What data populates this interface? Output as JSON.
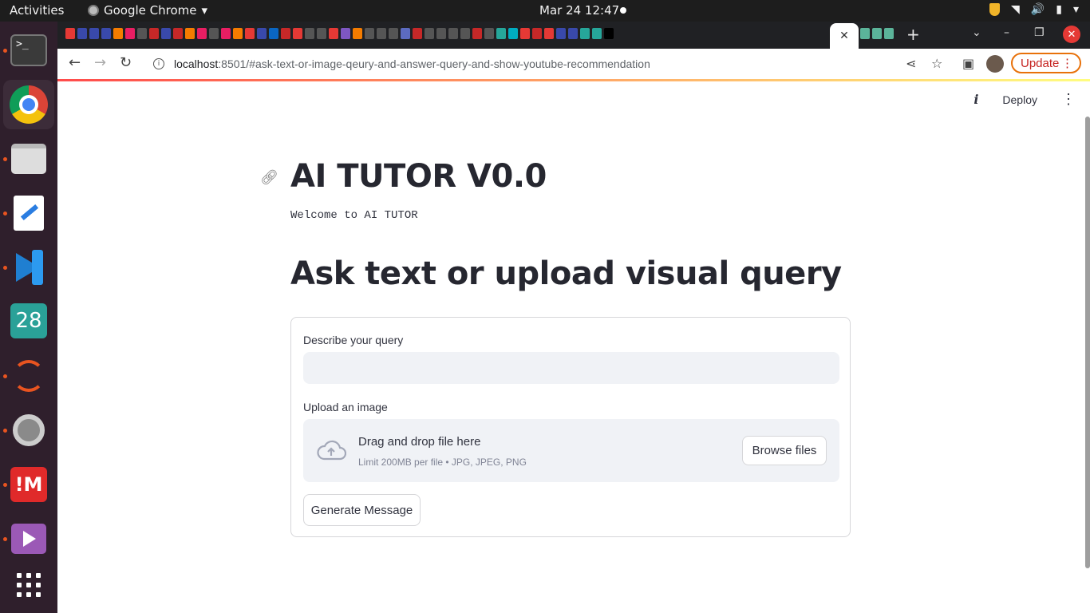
{
  "topbar": {
    "activities": "Activities",
    "app_name": "Google Chrome",
    "datetime": "Mar 24  12:47"
  },
  "dock": {
    "calendar_day": "28",
    "im_label": "!M"
  },
  "browser": {
    "tab_close": "✕",
    "new_tab": "+",
    "url_host": "localhost",
    "url_rest": ":8501/#ask-text-or-image-qeury-and-answer-query-and-show-youtube-recommendation",
    "update_label": "Update"
  },
  "streamlit": {
    "deploy_label": "Deploy",
    "title": "AI TUTOR V0.0",
    "welcome": "Welcome to AI TUTOR",
    "section_title": "Ask text or upload visual query",
    "query_label": "Describe your query",
    "query_value": "",
    "upload_label": "Upload an image",
    "dropzone_title": "Drag and drop file here",
    "dropzone_limits": "Limit 200MB per file • JPG, JPEG, PNG",
    "browse_label": "Browse files",
    "generate_label": "Generate Message"
  },
  "colors": {
    "accent_gradient_start": "#ff4b4b",
    "accent_gradient_end": "#fffd80",
    "update_border": "#e8710a",
    "dock_bg": "#2f1f2c"
  }
}
